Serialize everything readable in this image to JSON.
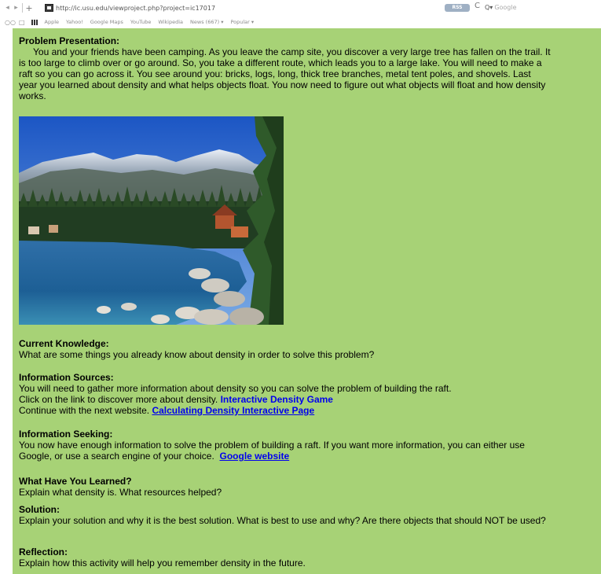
{
  "browser": {
    "nav_back": "◂",
    "nav_forward": "▸",
    "new_tab": "+",
    "url": "http://ic.usu.edu/viewproject.php?project=ic17017",
    "rss_badge": "RSS",
    "reload_icon": "C",
    "search_glyph": "Q▾",
    "search_placeholder": "Google",
    "bookmarks": [
      "Apple",
      "Yahoo!",
      "Google Maps",
      "YouTube",
      "Wikipedia",
      "News (667) ▾",
      "Popular ▾"
    ]
  },
  "page": {
    "background_color": "#a7d276",
    "problem_presentation": {
      "heading": "Problem Presentation:",
      "lines": [
        "You and your friends have been camping. As you leave the camp site, you discover a very large tree has fallen on the trail. It",
        "is too large to climb over or go around. So, you take a different route, which leads you to a large lake. You will need to    make a",
        "raft so you can go across it. You see around you: bricks, logs, long, thick tree branches, metal tent poles, and shovels. Last",
        "year you learned about density and what helps objects float. You now need to figure out what objects will float and how density",
        "works."
      ]
    },
    "current_knowledge": {
      "heading": "Current Knowledge:",
      "text": "What are some things you already know about density in order to solve this problem?"
    },
    "information_sources": {
      "heading": "Information Sources:",
      "line1": "You will need to gather more information about density so you can solve the problem of building the raft.",
      "line2_text": "Click on the link to discover more about density.",
      "line2_link": "Interactive Density Game",
      "line3_text": "Continue with the next website.",
      "line3_link": "Calculating Density Interactive Page"
    },
    "information_seeking": {
      "heading": "Information Seeking:",
      "line1": "You now have enough information to solve the problem of building a raft.  If you want more information, you can either use",
      "line2_text": "Google, or use a search engine of your choice.",
      "line2_link": "Google website"
    },
    "what_learned": {
      "heading": "What Have You Learned?",
      "text": "Explain what density is. What resources helped?"
    },
    "solution": {
      "heading": "Solution:",
      "text": "Explain your solution and why it is the best solution. What is best to use and why?  Are there objects that should NOT be used?"
    },
    "reflection": {
      "heading": "Reflection:",
      "text": "Explain how this activity will help you remember density in the future."
    }
  }
}
